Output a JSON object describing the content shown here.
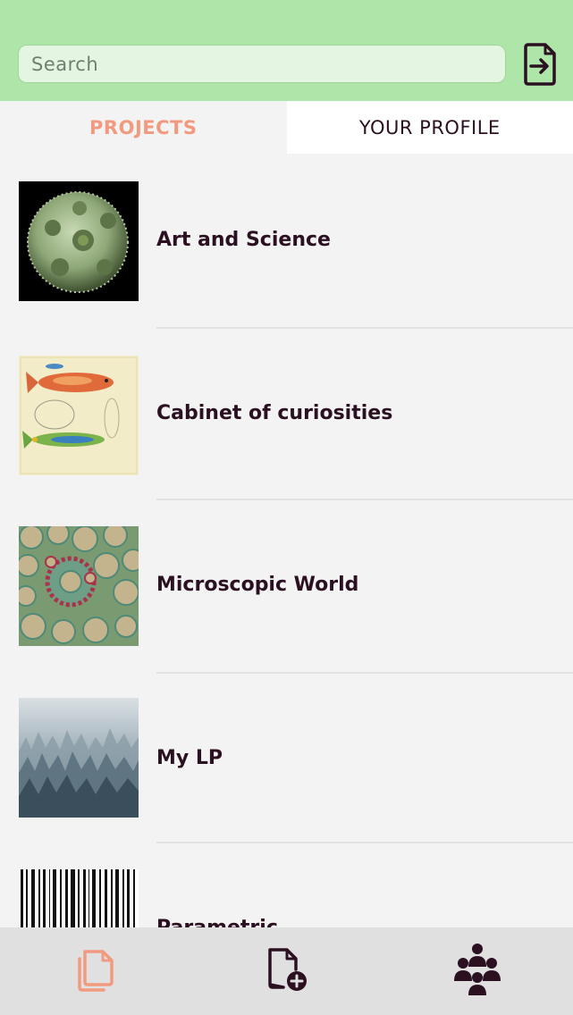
{
  "search": {
    "placeholder": "Search"
  },
  "header": {
    "export_icon": "file-export-icon"
  },
  "tabs": [
    {
      "label": "PROJECTS",
      "active": true
    },
    {
      "label": "YOUR PROFILE",
      "active": false
    }
  ],
  "projects": [
    {
      "title": "Art and Science",
      "thumb": "pollen-grain-image"
    },
    {
      "title": "Cabinet of curiosities",
      "thumb": "fish-illustration-image"
    },
    {
      "title": "Microscopic World",
      "thumb": "plant-cells-image"
    },
    {
      "title": "My LP",
      "thumb": "misty-forest-image"
    },
    {
      "title": "Parametric",
      "thumb": "barcode-image"
    }
  ],
  "bottom_nav": [
    {
      "icon": "documents-icon",
      "active": true
    },
    {
      "icon": "add-document-icon",
      "active": false
    },
    {
      "icon": "group-icon",
      "active": false
    }
  ],
  "colors": {
    "header_bg": "#ade6a8",
    "accent": "#f29a7f",
    "text_dark": "#2b1022",
    "list_bg": "#f3f3f3",
    "bottom_bar_bg": "#e0e0e0"
  }
}
